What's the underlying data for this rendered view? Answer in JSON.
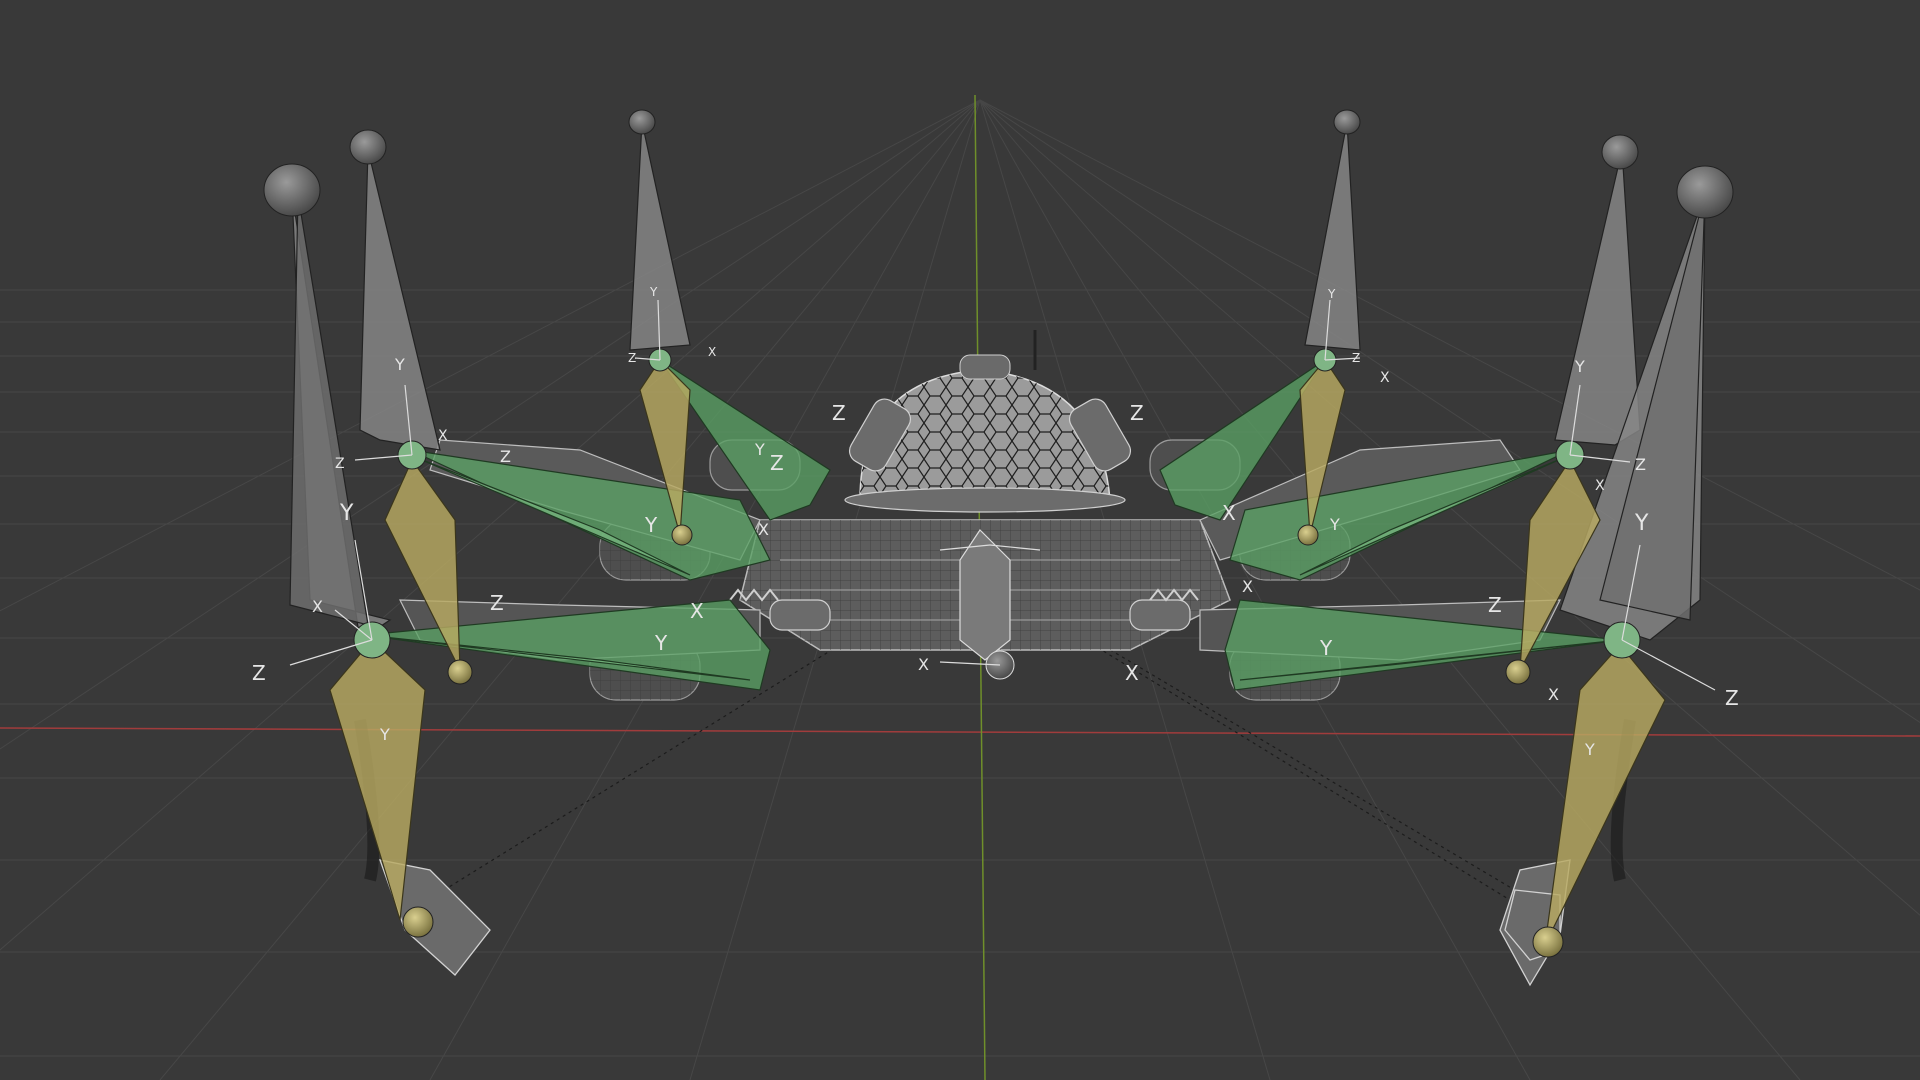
{
  "viewport": {
    "colors": {
      "background": "#393939",
      "grid": "#474747",
      "x_axis": "#a13c3c",
      "y_axis": "#6f8f2a",
      "bone_gray": "#8c8c8c",
      "bone_green": "#5e9e63",
      "bone_yellow": "#a89a56",
      "mesh": "#bcbcbc"
    },
    "axis_labels": {
      "x": "X",
      "y": "Y",
      "z": "Z"
    }
  }
}
